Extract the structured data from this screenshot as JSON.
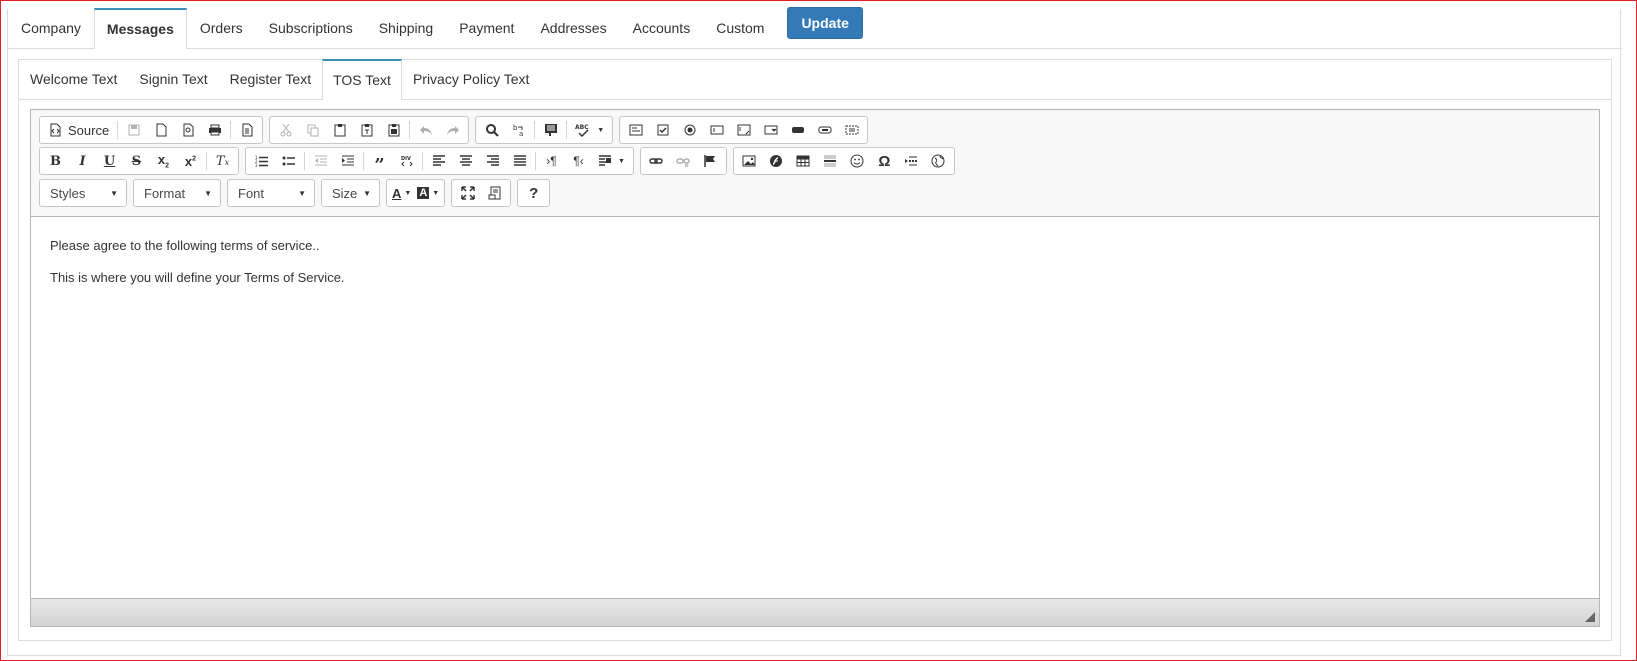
{
  "main_tabs": [
    "Company",
    "Messages",
    "Orders",
    "Subscriptions",
    "Shipping",
    "Payment",
    "Addresses",
    "Accounts",
    "Custom"
  ],
  "active_main_tab": "Messages",
  "update_label": "Update",
  "sub_tabs": [
    "Welcome Text",
    "Signin Text",
    "Register Text",
    "TOS Text",
    "Privacy Policy Text"
  ],
  "active_sub_tab": "TOS Text",
  "toolbar": {
    "source_label": "Source",
    "styles_label": "Styles",
    "format_label": "Format",
    "font_label": "Font",
    "size_label": "Size"
  },
  "content": {
    "para1": "Please agree to the following terms of service..",
    "para2": "This is where you will define your Terms of Service."
  },
  "colors": {
    "accent": "#337ab7",
    "tab_active_border": "#3a8fb7",
    "frame": "#d22222"
  }
}
